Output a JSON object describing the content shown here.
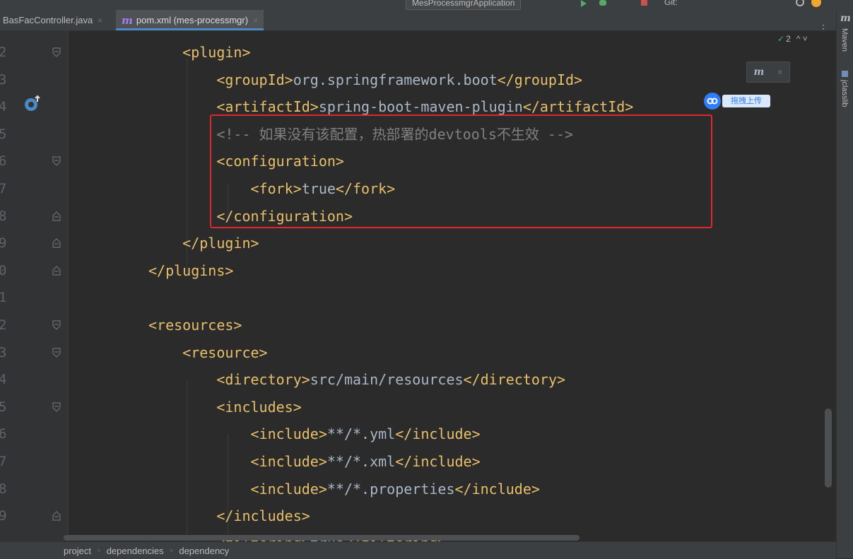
{
  "tabs": [
    {
      "label": "BasFacController.java",
      "close": "×"
    },
    {
      "label": "pom.xml (mes-processmgr)",
      "close": "×",
      "icon": "maven-m-icon"
    }
  ],
  "toolbar": {
    "run_config": "MesProcessmgrApplication",
    "git_label": "Git:"
  },
  "tab_menu": "⋮",
  "line_numbers": [
    "2",
    "3",
    "4",
    "5",
    "6",
    "7",
    "8",
    "9",
    "0",
    "1",
    "2",
    "3",
    "4",
    "5",
    "6",
    "7",
    "8",
    "9"
  ],
  "code_lines": [
    {
      "tokens": [
        {
          "t": "    <plugin>",
          "c": "tag"
        }
      ]
    },
    {
      "tokens": [
        {
          "t": "        <groupId>",
          "c": "tag"
        },
        {
          "t": "org.springframework.boot",
          "c": "text"
        },
        {
          "t": "</groupId>",
          "c": "tag"
        }
      ]
    },
    {
      "tokens": [
        {
          "t": "        <artifactId>",
          "c": "tag"
        },
        {
          "t": "spring-boot-maven-plugin",
          "c": "text"
        },
        {
          "t": "</artifactId>",
          "c": "tag"
        }
      ]
    },
    {
      "tokens": [
        {
          "t": "        <!-- 如果没有该配置，热部署的devtools不生效 -->",
          "c": "comment"
        }
      ]
    },
    {
      "tokens": [
        {
          "t": "        <configuration>",
          "c": "tag"
        }
      ]
    },
    {
      "tokens": [
        {
          "t": "            <fork>",
          "c": "tag"
        },
        {
          "t": "true",
          "c": "text"
        },
        {
          "t": "</fork>",
          "c": "tag"
        }
      ]
    },
    {
      "tokens": [
        {
          "t": "        </configuration>",
          "c": "tag"
        }
      ]
    },
    {
      "tokens": [
        {
          "t": "    </plugin>",
          "c": "tag"
        }
      ]
    },
    {
      "tokens": [
        {
          "t": "</plugins>",
          "c": "tag"
        }
      ]
    },
    {
      "tokens": [
        {
          "t": "",
          "c": "text"
        }
      ]
    },
    {
      "tokens": [
        {
          "t": "<resources>",
          "c": "tag"
        }
      ]
    },
    {
      "tokens": [
        {
          "t": "    <resource>",
          "c": "tag"
        }
      ]
    },
    {
      "tokens": [
        {
          "t": "        <directory>",
          "c": "tag"
        },
        {
          "t": "src/main/resources",
          "c": "text"
        },
        {
          "t": "</directory>",
          "c": "tag"
        }
      ]
    },
    {
      "tokens": [
        {
          "t": "        <includes>",
          "c": "tag"
        }
      ]
    },
    {
      "tokens": [
        {
          "t": "            <include>",
          "c": "tag"
        },
        {
          "t": "**/*.yml",
          "c": "text"
        },
        {
          "t": "</include>",
          "c": "tag"
        }
      ]
    },
    {
      "tokens": [
        {
          "t": "            <include>",
          "c": "tag"
        },
        {
          "t": "**/*.xml",
          "c": "text"
        },
        {
          "t": "</include>",
          "c": "tag"
        }
      ]
    },
    {
      "tokens": [
        {
          "t": "            <include>",
          "c": "tag"
        },
        {
          "t": "**/*.properties",
          "c": "text"
        },
        {
          "t": "</include>",
          "c": "tag"
        }
      ]
    },
    {
      "tokens": [
        {
          "t": "        </includes>",
          "c": "tag"
        }
      ]
    },
    {
      "tokens": [
        {
          "t": "        <filtering>",
          "c": "tag"
        },
        {
          "t": "true",
          "c": "text"
        },
        {
          "t": "</filtering>",
          "c": "tag"
        }
      ]
    }
  ],
  "colors": {
    "tag": "#e8bf6a",
    "text": "#a9b7c6",
    "comment": "#808080",
    "highlight_border": "#e0282a",
    "accent": "#4a88c7"
  },
  "inspection": {
    "count": "2",
    "arrows": "^ ˅"
  },
  "maven_popup": {
    "close": "×"
  },
  "cloud_upload": {
    "label": "拖拽上传"
  },
  "right_tools": {
    "maven": "Maven",
    "jclasslib": "jclasslib"
  },
  "breadcrumb": [
    "project",
    "dependencies",
    "dependency"
  ]
}
